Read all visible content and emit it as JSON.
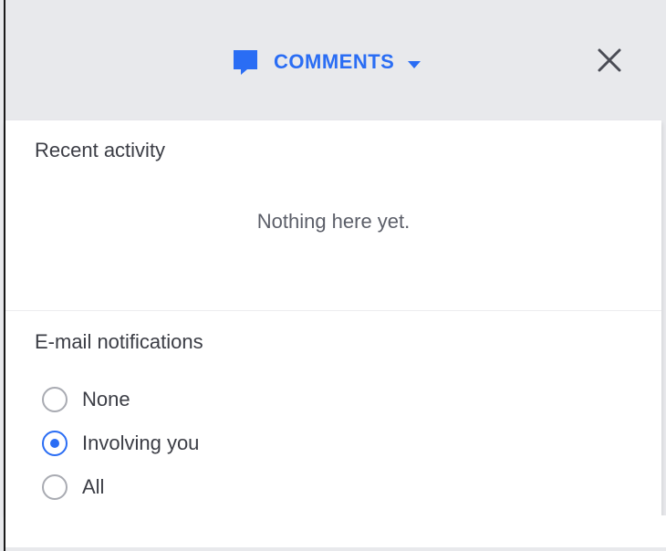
{
  "header": {
    "toggle_label": "COMMENTS",
    "accent_color": "#2a6df4"
  },
  "panel": {
    "recent_title": "Recent activity",
    "empty_message": "Nothing here yet.",
    "email_title": "E-mail notifications",
    "options": [
      {
        "label": "None",
        "checked": false
      },
      {
        "label": "Involving you",
        "checked": true
      },
      {
        "label": "All",
        "checked": false
      }
    ]
  },
  "icons": {
    "comment": "comment-bubble-icon",
    "caret": "caret-down-icon",
    "close": "close-icon"
  }
}
